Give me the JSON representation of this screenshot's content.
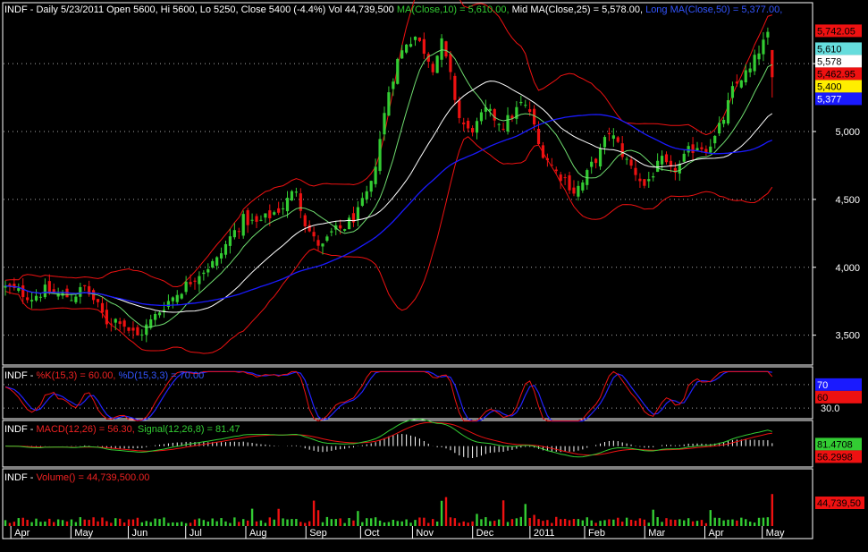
{
  "colors": {
    "up": "#33cc33",
    "down": "#ee1111",
    "ma10": "#ffffff",
    "ma25": "#ffffff",
    "ma50": "#1a1aff",
    "band": "#ee1111",
    "k": "#ee1111",
    "d": "#2222ff",
    "macd": "#33cc33",
    "signal": "#ee1111",
    "axis": "#ffffff"
  },
  "header": {
    "sym": "INDF",
    "price_info": " - Daily 5/23/2011 Open 5600, Hi 5600, Lo 5250, Close 5400 (-4.4%) Vol 44,739,500 ",
    "ma10": "MA(Close,10) = 5,610.00,",
    "ma25": " Mid MA(Close,25) = 5,578.00,",
    "ma50": " Long MA(Close,50) = 5,377.00,"
  },
  "stoch_header": {
    "sym": "INDF",
    "sep": " - ",
    "k": "%K(15,3) = 60.00,",
    "d": " %D(15,3,3) = 70.00"
  },
  "macd_header": {
    "sym": "INDF",
    "sep": " - ",
    "macd": "MACD(12,26) = 56.30,",
    "signal": " Signal(12,26,8) = 81.47"
  },
  "volume_header": {
    "sym": "INDF",
    "sep": " - ",
    "vol": "Volume() = 44,739,500.00"
  },
  "price_axis_badges": [
    {
      "text": "5,742.05",
      "value": 5742,
      "bg": "#ee1111",
      "fg": "#000000"
    },
    {
      "text": "5,610",
      "value": 5610,
      "bg": "#66dddd",
      "fg": "#000000"
    },
    {
      "text": "5,578",
      "value": 5578,
      "bg": "#ffffff",
      "fg": "#000000"
    },
    {
      "text": "5,462.95",
      "value": 5463,
      "bg": "#ee1111",
      "fg": "#000000"
    },
    {
      "text": "5,400",
      "value": 5400,
      "bg": "#ffee00",
      "fg": "#000000"
    },
    {
      "text": "5,377",
      "value": 5377,
      "bg": "#1a1aff",
      "fg": "#ffffff"
    }
  ],
  "stoch_badges": [
    {
      "text": "70",
      "value": 70,
      "bg": "#1a1aff",
      "fg": "#ffffff"
    },
    {
      "text": "60",
      "value": 60,
      "bg": "#ee1111",
      "fg": "#000000"
    }
  ],
  "macd_badges": [
    {
      "text": "81.4708",
      "value": 81.47,
      "bg": "#33cc33",
      "fg": "#000000"
    },
    {
      "text": "56.2998",
      "value": 56.3,
      "bg": "#ee1111",
      "fg": "#000000"
    }
  ],
  "volume_badges": [
    {
      "text": "44,739,50",
      "value": 44739500,
      "bg": "#ee1111",
      "fg": "#000000"
    }
  ],
  "chart_data": [
    {
      "type": "candlestick",
      "panel": "price",
      "ylim": [
        3300,
        5850
      ],
      "ytick_values": [
        3500,
        4000,
        4500,
        5000,
        5500
      ],
      "ytick_labels": [
        "3,500",
        "4,000",
        "4,500",
        "5,000",
        ""
      ],
      "grid": true,
      "bars": 175,
      "keypoints": [
        [
          0,
          3850
        ],
        [
          3,
          3820
        ],
        [
          6,
          3780
        ],
        [
          9,
          3830
        ],
        [
          12,
          3800
        ],
        [
          15,
          3780
        ],
        [
          18,
          3850
        ],
        [
          20,
          3760
        ],
        [
          23,
          3600
        ],
        [
          26,
          3620
        ],
        [
          28,
          3540
        ],
        [
          30,
          3490
        ],
        [
          33,
          3600
        ],
        [
          36,
          3720
        ],
        [
          40,
          3840
        ],
        [
          44,
          3960
        ],
        [
          48,
          4050
        ],
        [
          51,
          4220
        ],
        [
          54,
          4350
        ],
        [
          57,
          4320
        ],
        [
          60,
          4380
        ],
        [
          63,
          4450
        ],
        [
          66,
          4580
        ],
        [
          68,
          4330
        ],
        [
          70,
          4200
        ],
        [
          72,
          4150
        ],
        [
          74,
          4250
        ],
        [
          77,
          4300
        ],
        [
          80,
          4400
        ],
        [
          83,
          4600
        ],
        [
          85,
          4950
        ],
        [
          87,
          5300
        ],
        [
          89,
          5520
        ],
        [
          91,
          5660
        ],
        [
          93,
          5700
        ],
        [
          95,
          5600
        ],
        [
          97,
          5480
        ],
        [
          99,
          5650
        ],
        [
          101,
          5400
        ],
        [
          103,
          5100
        ],
        [
          105,
          5000
        ],
        [
          107,
          5050
        ],
        [
          109,
          5150
        ],
        [
          111,
          5100
        ],
        [
          113,
          5050
        ],
        [
          115,
          5120
        ],
        [
          117,
          5200
        ],
        [
          119,
          5150
        ],
        [
          121,
          4900
        ],
        [
          123,
          4800
        ],
        [
          125,
          4700
        ],
        [
          127,
          4650
        ],
        [
          129,
          4560
        ],
        [
          131,
          4620
        ],
        [
          133,
          4750
        ],
        [
          135,
          4850
        ],
        [
          137,
          5000
        ],
        [
          139,
          4900
        ],
        [
          141,
          4780
        ],
        [
          143,
          4700
        ],
        [
          145,
          4600
        ],
        [
          147,
          4700
        ],
        [
          149,
          4780
        ],
        [
          151,
          4700
        ],
        [
          153,
          4750
        ],
        [
          155,
          4850
        ],
        [
          157,
          4900
        ],
        [
          159,
          4880
        ],
        [
          161,
          4950
        ],
        [
          163,
          5100
        ],
        [
          165,
          5300
        ],
        [
          167,
          5400
        ],
        [
          169,
          5450
        ],
        [
          171,
          5600
        ],
        [
          172,
          5650
        ],
        [
          173,
          5700
        ],
        [
          174,
          5400
        ]
      ],
      "series": [
        {
          "name": "MA(Close,10)"
        },
        {
          "name": "Mid MA(Close,25)"
        },
        {
          "name": "Long MA(Close,50)"
        }
      ]
    },
    {
      "type": "line",
      "panel": "stochastic",
      "ylim": [
        15,
        85
      ],
      "ytick_values": [
        30,
        70
      ],
      "ytick_labels": [
        "30.0",
        "70.0"
      ],
      "series": [
        {
          "name": "%K(15,3)"
        },
        {
          "name": "%D(15,3,3)"
        }
      ]
    },
    {
      "type": "histogram+line",
      "panel": "macd",
      "ylim": [
        -260,
        300
      ],
      "series": [
        {
          "name": "MACD(12,26)"
        },
        {
          "name": "Signal(12,26,8)"
        }
      ]
    },
    {
      "type": "bar",
      "panel": "volume",
      "ylim": [
        0,
        60000000
      ],
      "series": [
        {
          "name": "Volume()"
        }
      ]
    }
  ],
  "x_axis": {
    "labels": [
      "Apr",
      "May",
      "Jun",
      "Jul",
      "Aug",
      "Sep",
      "Oct",
      "Nov",
      "Dec",
      "2011",
      "Feb",
      "Mar",
      "Apr",
      "May"
    ],
    "bar_index": [
      2,
      24,
      45,
      66,
      88,
      110,
      130,
      149,
      171,
      192,
      212,
      234,
      256,
      277
    ]
  }
}
